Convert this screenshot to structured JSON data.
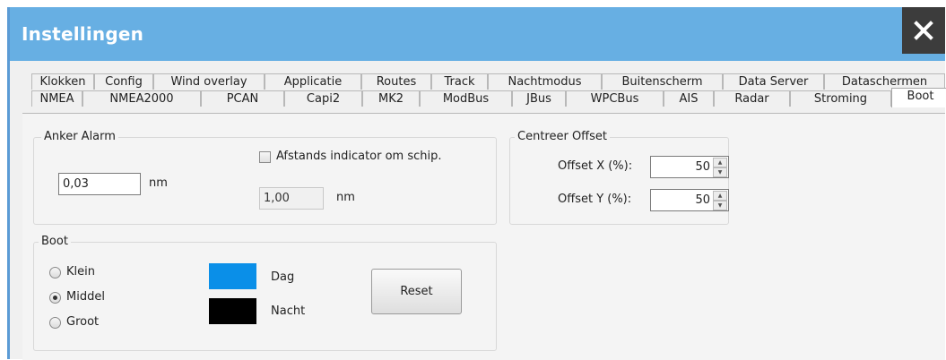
{
  "window": {
    "title": "Instellingen",
    "close_icon": "close-icon"
  },
  "tabs_row1": [
    "Klokken",
    "Config",
    "Wind overlay",
    "Applicatie",
    "Routes",
    "Track",
    "Nachtmodus",
    "Buitenscherm",
    "Data Server",
    "Dataschermen"
  ],
  "tabs_row2": [
    "NMEA",
    "NMEA2000",
    "PCAN",
    "Capi2",
    "MK2",
    "ModBus",
    "JBus",
    "WPCBus",
    "AIS",
    "Radar",
    "Stroming",
    "Boot"
  ],
  "active_tab": "Boot",
  "anker": {
    "title": "Anker Alarm",
    "value": "0,03",
    "unit": "nm",
    "checkbox_label": "Afstands indicator om schip.",
    "checkbox_checked": false,
    "indicator_value": "1,00",
    "indicator_unit": "nm"
  },
  "centreer": {
    "title": "Centreer Offset",
    "x_label": "Offset X (%):",
    "x_value": "50",
    "y_label": "Offset Y (%):",
    "y_value": "50"
  },
  "boot": {
    "title": "Boot",
    "sizes": [
      "Klein",
      "Middel",
      "Groot"
    ],
    "selected_size": "Middel",
    "day_label": "Dag",
    "day_color": "#0a8fe8",
    "night_label": "Nacht",
    "night_color": "#000000",
    "reset_label": "Reset"
  }
}
